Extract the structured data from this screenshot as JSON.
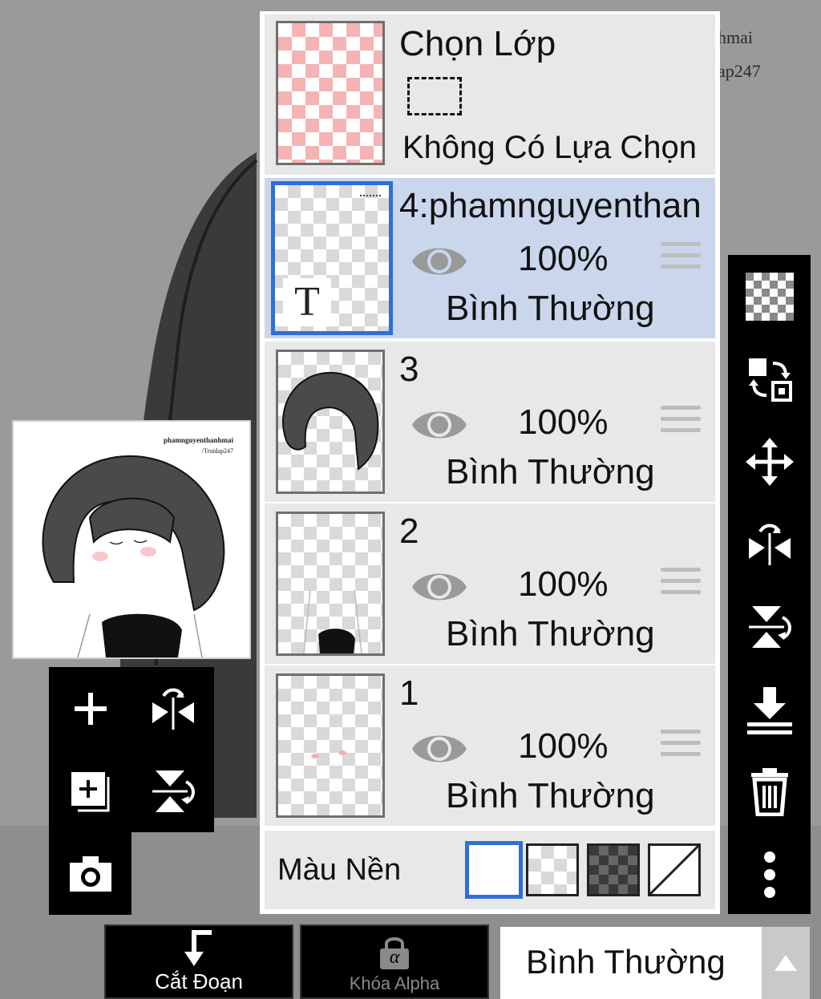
{
  "background": {
    "watermark_line1": "hmai",
    "watermark_line2": "ap247"
  },
  "preview": {
    "watermark_line1": "phamnguyenthanhmai",
    "watermark_line2": "/Truidap247"
  },
  "selection_row": {
    "title": "Chọn Lớp",
    "subtitle": "Không Có Lựa Chọn"
  },
  "layers": [
    {
      "name": "4:phamnguyenthan",
      "opacity": "100%",
      "blend": "Bình Thường",
      "thumb_letter": "T"
    },
    {
      "name": "3",
      "opacity": "100%",
      "blend": "Bình Thường"
    },
    {
      "name": "2",
      "opacity": "100%",
      "blend": "Bình Thường"
    },
    {
      "name": "1",
      "opacity": "100%",
      "blend": "Bình Thường"
    }
  ],
  "background_color": {
    "label": "Màu Nền"
  },
  "bottom_bar": {
    "cut_label": "Cắt Đoạn",
    "alpha_label": "Khóa Alpha",
    "alpha_glyph": "α",
    "blend_mode": "Bình Thường"
  },
  "colors": {
    "accent": "#2f6fd6",
    "selected_row": "#c9d6ec",
    "row": "#e8e8e8",
    "toolbar": "#000000"
  }
}
